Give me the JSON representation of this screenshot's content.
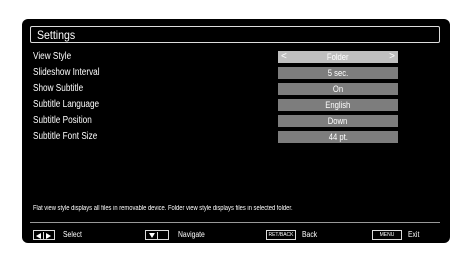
{
  "settings": {
    "title": "Settings",
    "rows": [
      {
        "label": "View Style",
        "value": "Folder"
      },
      {
        "label": "Slideshow Interval",
        "value": "5 sec."
      },
      {
        "label": "Show Subtitle",
        "value": "On"
      },
      {
        "label": "Subtitle Language",
        "value": "English"
      },
      {
        "label": "Subtitle Position",
        "value": "Down"
      },
      {
        "label": "Subtitle Font Size",
        "value": "44 pt."
      }
    ],
    "description": "Flat view style displays all files in removable device. Folder view style displays files in selected folder."
  },
  "arrows": {
    "left": "<",
    "right": ">"
  },
  "footer": {
    "select": "Select",
    "navigate": "Navigate",
    "back_key": "RET/BACK",
    "back": "Back",
    "menu_key": "MENU",
    "exit": "Exit"
  },
  "colors": {
    "background": "#000000",
    "value_box": "#7d7d7d",
    "selected_value_box": "#bfbfbf"
  }
}
